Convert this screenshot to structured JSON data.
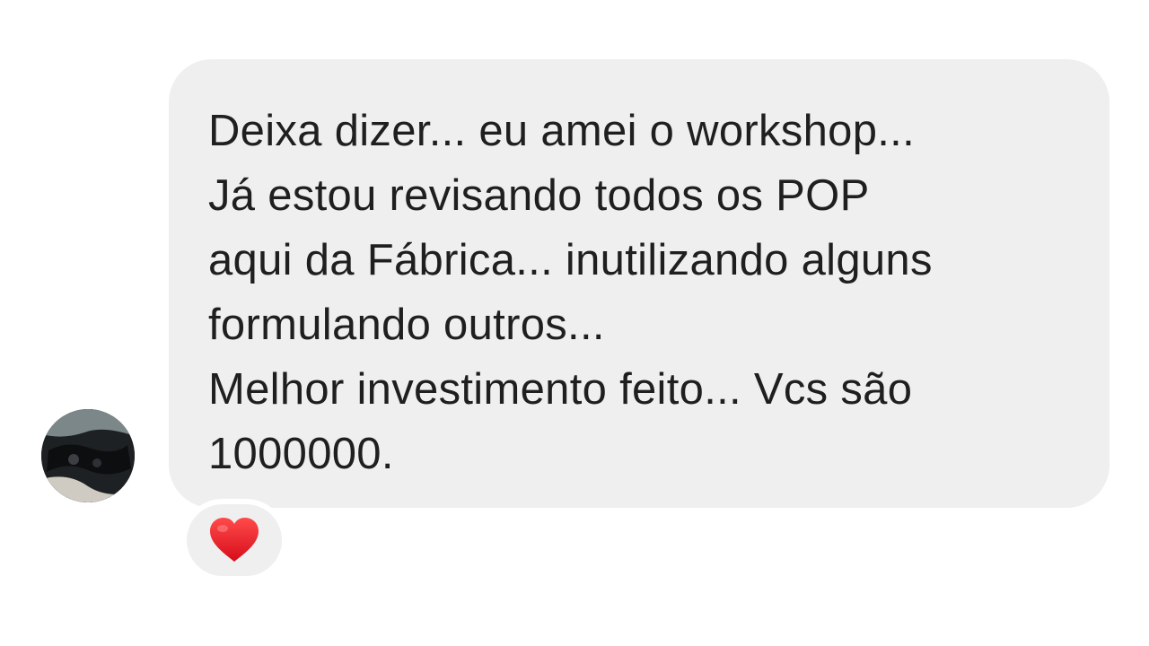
{
  "message": {
    "text": "Deixa dizer... eu amei o workshop...\nJá estou revisando todos os POP\naqui da Fábrica... inutilizando alguns\nformulando outros...\nMelhor investimento feito... Vcs são\n1000000."
  },
  "reaction": {
    "icon": "heart-icon",
    "color": "#e5131f"
  },
  "colors": {
    "bubble": "#efefef",
    "text": "#1f1f1f",
    "background": "#ffffff"
  }
}
